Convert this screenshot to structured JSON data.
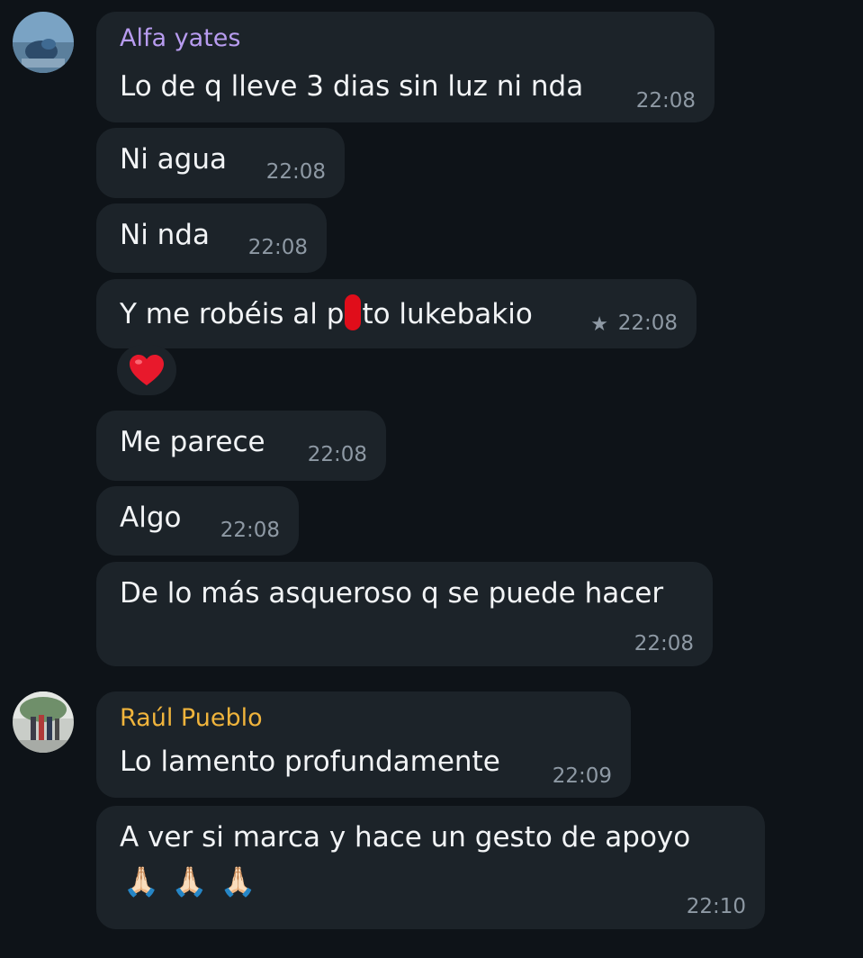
{
  "theme": {
    "background": "#0e1318",
    "bubble": "#1c2329",
    "text": "#f2f4f6",
    "time": "#8e99a4",
    "sender1_color": "#b89cf0",
    "sender2_color": "#f0b43c",
    "heart_color": "#e8192c"
  },
  "messages": [
    {
      "sender": "Alfa yates",
      "text": "Lo de q lleve 3 dias sin luz ni nda",
      "time": "22:08"
    },
    {
      "text": "Ni agua",
      "time": "22:08"
    },
    {
      "text": "Ni nda",
      "time": "22:08"
    },
    {
      "text_before": "Y me robéis al p",
      "text_after": "to lukebakio",
      "time": "22:08",
      "starred": true,
      "reaction": "heart-emoji"
    },
    {
      "text": "Me parece",
      "time": "22:08"
    },
    {
      "text": "Algo",
      "time": "22:08"
    },
    {
      "text": "De lo más asqueroso q se puede hacer",
      "time": "22:08"
    },
    {
      "sender": "Raúl Pueblo",
      "text": "Lo lamento profundamente",
      "time": "22:09"
    },
    {
      "text": "A ver si marca y hace un gesto de apoyo",
      "emoji": "🙏🏻🙏🏻🙏🏻",
      "time": "22:10"
    }
  ]
}
